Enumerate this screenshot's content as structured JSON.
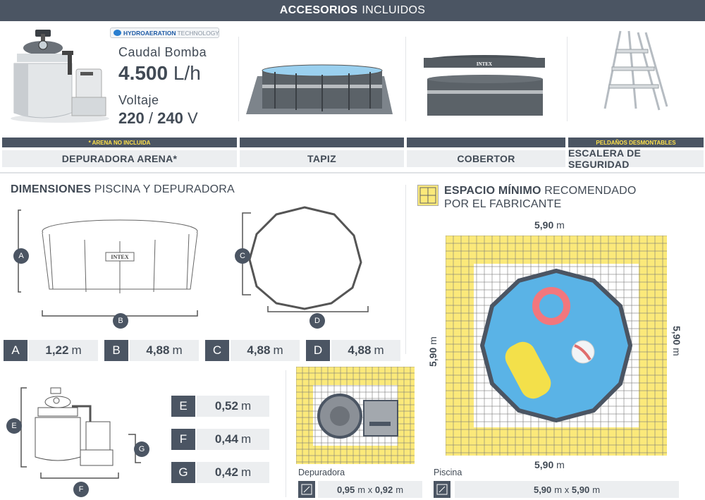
{
  "header": {
    "bold": "ACCESORIOS",
    "rest": "INCLUIDOS"
  },
  "badge": {
    "text": "HYDROAERATION",
    "text2": "TECHNOLOGY"
  },
  "pump": {
    "flow_label": "Caudal Bomba",
    "flow_value": "4.500",
    "flow_unit": "L/h",
    "voltage_label": "Voltaje",
    "voltage_a": "220",
    "voltage_sep": "/",
    "voltage_b": "240",
    "voltage_unit": "V"
  },
  "cover_brand": "INTEX",
  "accessories": [
    {
      "note": "* ARENA NO INCLUIDA",
      "name": "DEPURADORA ARENA*"
    },
    {
      "note": "",
      "name": "TAPIZ"
    },
    {
      "note": "",
      "name": "COBERTOR"
    },
    {
      "note": "PELDAÑOS DESMONTABLES",
      "name": "ESCALERA DE SEGURIDAD"
    }
  ],
  "dimensions": {
    "title_bold": "DIMENSIONES",
    "title_rest": "PISCINA Y DEPURADORA",
    "pool_brand": "INTEX",
    "items": [
      {
        "label": "A",
        "value": "1,22",
        "unit": "m"
      },
      {
        "label": "B",
        "value": "4,88",
        "unit": "m"
      },
      {
        "label": "C",
        "value": "4,88",
        "unit": "m"
      },
      {
        "label": "D",
        "value": "4,88",
        "unit": "m"
      },
      {
        "label": "E",
        "value": "0,52",
        "unit": "m"
      },
      {
        "label": "F",
        "value": "0,44",
        "unit": "m"
      },
      {
        "label": "G",
        "value": "0,42",
        "unit": "m"
      }
    ]
  },
  "space": {
    "title_bold": "ESPACIO MÍNIMO",
    "title_rest": "RECOMENDADO",
    "title_line2": "POR EL FABRICANTE",
    "top": "5,90",
    "bottom": "5,90",
    "left": "5,90",
    "right": "5,90",
    "unit": "m",
    "depuradora_label": "Depuradora",
    "depuradora_w": "0,95",
    "depuradora_x": "x",
    "depuradora_h": "0,92",
    "piscina_label": "Piscina",
    "piscina_w": "5,90",
    "piscina_x": "x",
    "piscina_h": "5,90"
  },
  "colors": {
    "dark": "#4b5563",
    "light": "#eceef0",
    "yellow": "#fbe97a",
    "accent": "#ffe14a",
    "water": "#5ab3e6"
  }
}
